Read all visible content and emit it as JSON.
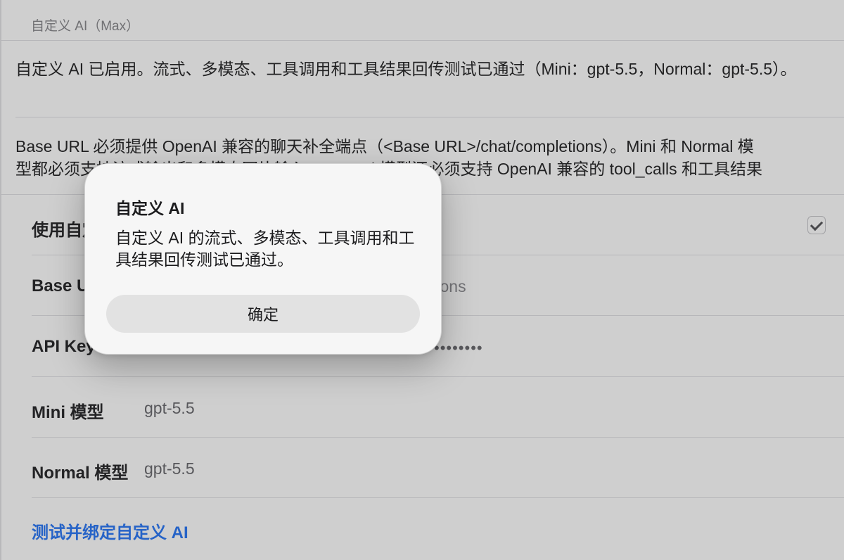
{
  "section": {
    "title": "自定义 AI（Max）"
  },
  "status_text": "自定义 AI 已启用。流式、多模态、工具调用和工具结果回传测试已通过（Mini：gpt-5.5，Normal：gpt-5.5）。",
  "info_text": {
    "line1": "Base URL 必须提供 OpenAI 兼容的聊天补全端点（<Base URL>/chat/completions）。Mini 和 Normal 模",
    "line2": "型都必须支持流式输出和多模态图片输入，Normal 模型还必须支持 OpenAI 兼容的 tool_calls 和工具结果"
  },
  "rows": {
    "enable_label": "使用自定义 AI",
    "enable_checked": true,
    "base_url_label": "Base URL",
    "base_url_value_visible_fragment": "tions",
    "api_key_label": "API Key",
    "api_key_mask": "••••••••",
    "mini_label": "Mini 模型",
    "mini_value": "gpt-5.5",
    "normal_label": "Normal 模型",
    "normal_value": "gpt-5.5"
  },
  "link_button": "测试并绑定自定义 AI",
  "dialog": {
    "title": "自定义 AI",
    "message": "自定义 AI 的流式、多模态、工具调用和工具结果回传测试已通过。",
    "ok_label": "确定"
  },
  "colors": {
    "accent": "#2f7bf5",
    "dialog_bg": "#f6f6f6",
    "dialog_button_bg": "#e2e2e2"
  }
}
